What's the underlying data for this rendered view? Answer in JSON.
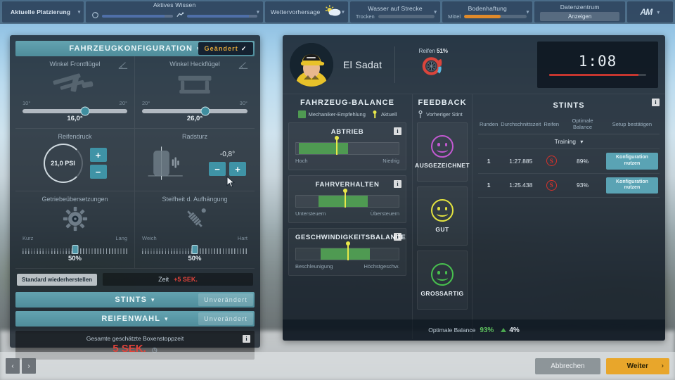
{
  "topbar": {
    "placing": {
      "label": "Aktuelle Platzierung",
      "chevron": "chevron-down"
    },
    "knowledge": {
      "label": "Aktives Wissen"
    },
    "weather": {
      "label": "Wettervorhersage"
    },
    "water": {
      "label": "Wasser auf Strecke",
      "value": "Trocken"
    },
    "grip": {
      "label": "Bodenhaftung",
      "value": "Mittel",
      "accent": "#e08a2a"
    },
    "datacenter": {
      "label": "Datenzentrum",
      "button": "Anzeigen"
    },
    "logo": {
      "mark": "AM"
    }
  },
  "setup": {
    "header": {
      "title": "FAHRZEUGKONFIGURATION",
      "status": "Geändert",
      "check": "✓"
    },
    "front_wing": {
      "title": "Winkel Frontflügel",
      "min": "10°",
      "max": "20°",
      "value": "16,0°",
      "percent": 60
    },
    "rear_wing": {
      "title": "Winkel Heckflügel",
      "min": "20°",
      "max": "30°",
      "value": "26,0°",
      "percent": 60
    },
    "tyre_pressure": {
      "title": "Reifendruck",
      "value": "21,0 PSI",
      "plus": "+",
      "minus": "−"
    },
    "camber": {
      "title": "Radsturz",
      "value": "-0,8°",
      "plus": "+",
      "minus": "−"
    },
    "gear_ratios": {
      "title": "Getriebeübersetzungen",
      "min": "Kurz",
      "max": "Lang",
      "value": "50%",
      "percent": 50
    },
    "suspension": {
      "title": "Steifheit d. Aufhängung",
      "min": "Weich",
      "max": "Hart",
      "value": "50%",
      "percent": 50
    },
    "restore_label": "Standard wiederherstellen",
    "time_label": "Zeit",
    "time_penalty": "+5 SEK.",
    "stints_bar": {
      "title": "STINTS",
      "status": "Unverändert"
    },
    "tyres_bar": {
      "title": "REIFENWAHL",
      "status": "Unverändert"
    },
    "pitstop": {
      "label": "Gesamte geschätzte Boxenstoppzeit",
      "value": "5 SEK.",
      "info": "i"
    }
  },
  "driver": {
    "name": "El Sadat",
    "tyre_label": "Reifen",
    "tyre_value": "51%",
    "lap_time": "1:08",
    "lap_progress": 92
  },
  "balance": {
    "title": "FAHRZEUG-BALANCE",
    "legend": [
      {
        "label": "Mechaniker-Empfehlung",
        "type": "swatch",
        "color": "#4f9a52"
      },
      {
        "label": "Aktuell",
        "type": "pin",
        "color": "#e8e84a"
      }
    ],
    "cards": [
      {
        "title": "ABTRIEB",
        "left": "Hoch",
        "right": "Niedrig",
        "fill_start": 3,
        "fill_width": 48,
        "marker": 39,
        "info": "i"
      },
      {
        "title": "FAHRVERHALTEN",
        "left": "Untersteuern",
        "right": "Übersteuern",
        "fill_start": 22,
        "fill_width": 48,
        "marker": 47,
        "info": "i"
      },
      {
        "title": "GESCHWINDIGKEITSBALANCE",
        "left": "Beschleunigung",
        "right": "Höchstgeschw.",
        "fill_start": 24,
        "fill_width": 48,
        "marker": 50,
        "info": "i"
      }
    ]
  },
  "feedback": {
    "title": "FEEDBACK",
    "legend": {
      "label": "Vorheriger Stint",
      "type": "pin-hollow"
    },
    "items": [
      {
        "label": "AUSGEZEICHNET",
        "mood": "excellent",
        "color": "#c259d1"
      },
      {
        "label": "GUT",
        "mood": "good",
        "color": "#e3e33f"
      },
      {
        "label": "GROSSARTIG",
        "mood": "great",
        "color": "#48c04e"
      }
    ]
  },
  "stints": {
    "title": "STINTS",
    "info": "i",
    "columns": [
      "Runden",
      "Durchschnittszeit",
      "Reifen",
      "Optimale Balance",
      "Setup bestätigen"
    ],
    "session": "Training",
    "rows": [
      {
        "laps": "1",
        "avg_time": "1:27.885",
        "tyre": "S",
        "balance": "89%",
        "action": "Konfiguration nutzen"
      },
      {
        "laps": "1",
        "avg_time": "1:25.438",
        "tyre": "S",
        "balance": "93%",
        "action": "Konfiguration nutzen"
      }
    ]
  },
  "optimal": {
    "label": "Optimale Balance",
    "value": "93%",
    "delta": "4%"
  },
  "bottombar": {
    "prev": "‹",
    "next_small": "›",
    "cancel": "Abbrechen",
    "next": "Weiter",
    "next_arrow": "›"
  }
}
